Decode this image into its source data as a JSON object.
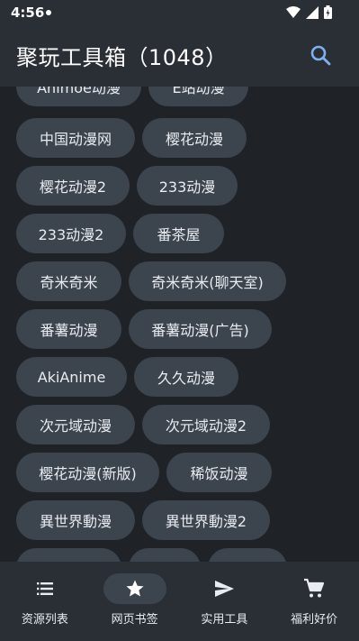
{
  "status_bar": {
    "time": "4:56"
  },
  "app_bar": {
    "title": "聚玩工具箱（1048）",
    "search_icon": "search-icon"
  },
  "chips": [
    {
      "label": "Animoe动漫"
    },
    {
      "label": "E站动漫"
    },
    {
      "label": "中国动漫网"
    },
    {
      "label": "樱花动漫"
    },
    {
      "label": "樱花动漫2"
    },
    {
      "label": "233动漫"
    },
    {
      "label": "233动漫2"
    },
    {
      "label": "番茶屋"
    },
    {
      "label": "奇米奇米"
    },
    {
      "label": "奇米奇米(聊天室)"
    },
    {
      "label": "番薯动漫"
    },
    {
      "label": "番薯动漫(广告)"
    },
    {
      "label": "AkiAnime"
    },
    {
      "label": "久久动漫"
    },
    {
      "label": "次元域动漫"
    },
    {
      "label": "次元域动漫2"
    },
    {
      "label": "樱花动漫(新版)"
    },
    {
      "label": "稀饭动漫"
    },
    {
      "label": "異世界動漫"
    },
    {
      "label": "異世界動漫2"
    }
  ],
  "bottom_nav": [
    {
      "label": "资源列表",
      "icon": "list-icon",
      "active": false
    },
    {
      "label": "网页书签",
      "icon": "star-icon",
      "active": true
    },
    {
      "label": "实用工具",
      "icon": "send-icon",
      "active": false
    },
    {
      "label": "福利好价",
      "icon": "cart-icon",
      "active": false
    }
  ],
  "colors": {
    "background": "#1f2328",
    "bar": "#2a2f36",
    "chip": "#3c444e",
    "accent": "#7fb0ee"
  }
}
